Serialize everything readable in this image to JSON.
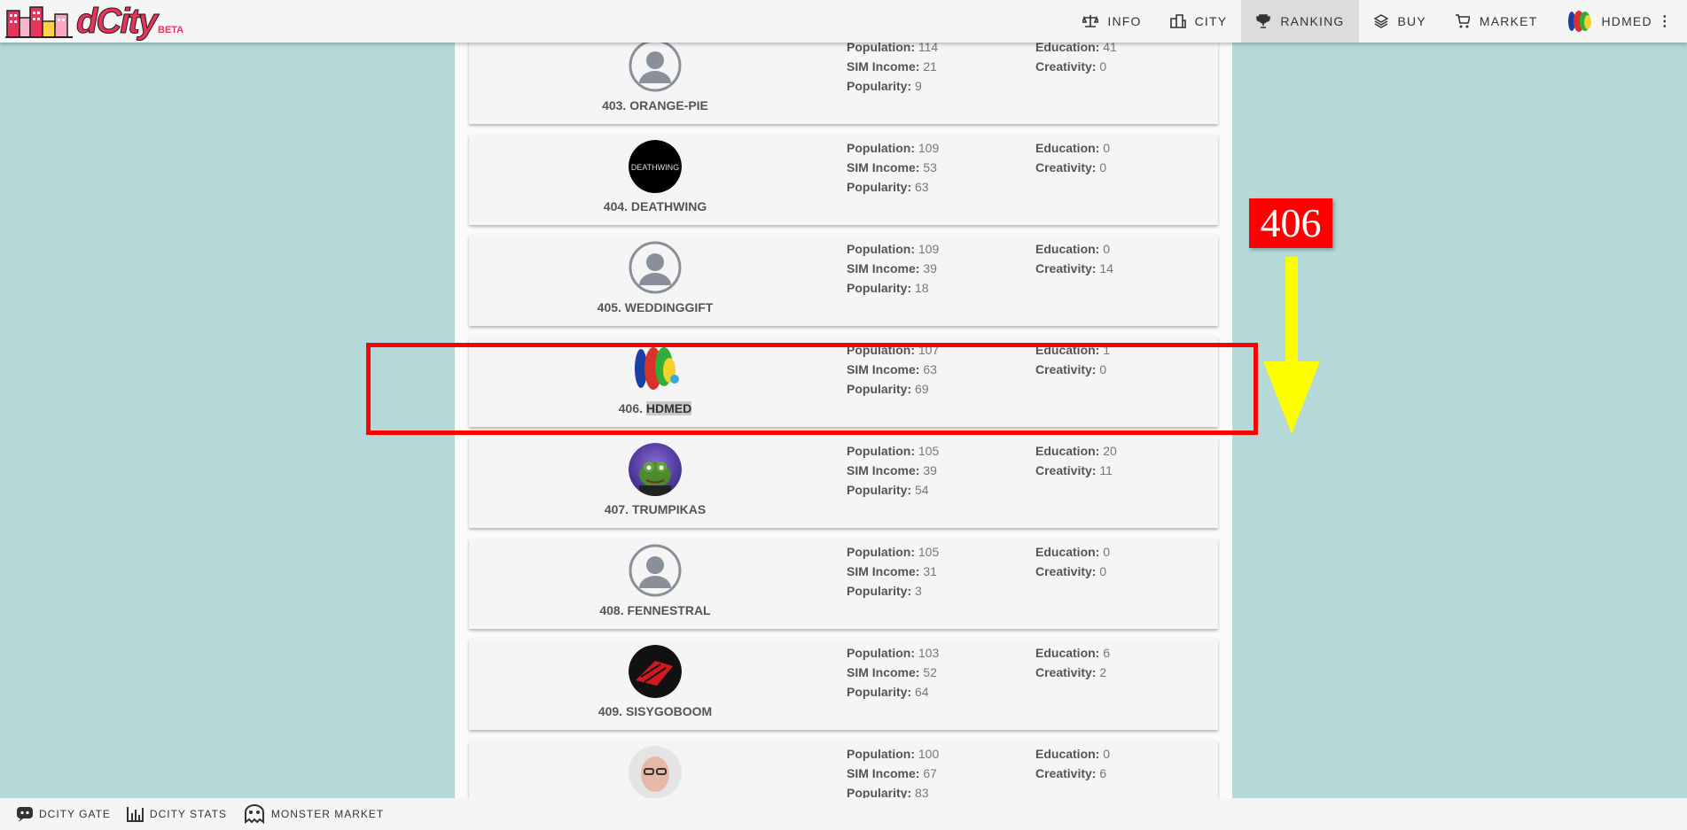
{
  "app": {
    "logo": "dCity",
    "beta": "BETA"
  },
  "nav": [
    {
      "label": "INFO",
      "icon": "scale-icon"
    },
    {
      "label": "CITY",
      "icon": "city-icon"
    },
    {
      "label": "RANKING",
      "icon": "trophy-icon",
      "active": true
    },
    {
      "label": "BUY",
      "icon": "layers-icon"
    },
    {
      "label": "MARKET",
      "icon": "cart-icon"
    },
    {
      "label": "HDMED",
      "icon": "user-avatar-icon"
    }
  ],
  "labels": {
    "population": "Population:",
    "sim_income": "SIM Income:",
    "popularity": "Popularity:",
    "education": "Education:",
    "creativity": "Creativity:"
  },
  "rankings": [
    {
      "rank": "403.",
      "name": "ORANGE-PIE",
      "population": "114",
      "sim_income": "21",
      "popularity": "9",
      "education": "41",
      "creativity": "0",
      "avatar": "default"
    },
    {
      "rank": "404.",
      "name": "DEATHWING",
      "population": "109",
      "sim_income": "53",
      "popularity": "63",
      "education": "0",
      "creativity": "0",
      "avatar": "deathwing",
      "avatar_text": "DEATHWING"
    },
    {
      "rank": "405.",
      "name": "WEDDINGGIFT",
      "population": "109",
      "sim_income": "39",
      "popularity": "18",
      "education": "0",
      "creativity": "14",
      "avatar": "default"
    },
    {
      "rank": "406.",
      "name": "HDMED",
      "population": "107",
      "sim_income": "63",
      "popularity": "69",
      "education": "1",
      "creativity": "0",
      "avatar": "hdmed"
    },
    {
      "rank": "407.",
      "name": "TRUMPIKAS",
      "population": "105",
      "sim_income": "39",
      "popularity": "54",
      "education": "20",
      "creativity": "11",
      "avatar": "frog"
    },
    {
      "rank": "408.",
      "name": "FENNESTRAL",
      "population": "105",
      "sim_income": "31",
      "popularity": "3",
      "education": "0",
      "creativity": "0",
      "avatar": "default"
    },
    {
      "rank": "409.",
      "name": "SISYGOBOOM",
      "population": "103",
      "sim_income": "52",
      "popularity": "64",
      "education": "6",
      "creativity": "2",
      "avatar": "red"
    },
    {
      "rank": "",
      "name": "",
      "population": "100",
      "sim_income": "67",
      "popularity": "83",
      "education": "0",
      "creativity": "6",
      "avatar": "photo"
    }
  ],
  "annotation": {
    "number": "406",
    "box_color": "#ff0000",
    "arrow_color": "#ffff00"
  },
  "footer": [
    {
      "label": "DCITY GATE",
      "icon": "discord-icon"
    },
    {
      "label": "DCITY STATS",
      "icon": "bar-chart-icon"
    },
    {
      "label": "MONSTER MARKET",
      "icon": "monster-icon"
    }
  ]
}
